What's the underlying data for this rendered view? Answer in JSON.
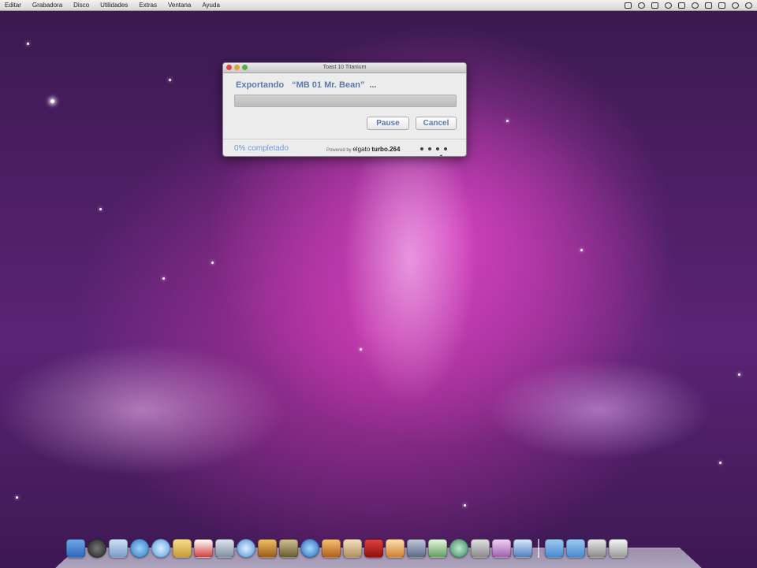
{
  "menubar": {
    "items": [
      "Editar",
      "Grabadora",
      "Disco",
      "Utilidades",
      "Extras",
      "Ventana",
      "Ayuda"
    ]
  },
  "dialog": {
    "title": "Toast 10 Titanium",
    "exporting_label": "Exportando",
    "filename": "“MB 01 Mr. Bean”",
    "ellipsis": "...",
    "progress_fraction": 0,
    "pause_label": "Pause",
    "cancel_label": "Cancel",
    "completed_text": "0% completado",
    "powered_by": "Powered by",
    "brand_prefix": "elgato",
    "brand_name": "turbo.264"
  },
  "colors": {
    "accent_text": "#5a7aa8",
    "progress_link": "#6a9bd6"
  }
}
